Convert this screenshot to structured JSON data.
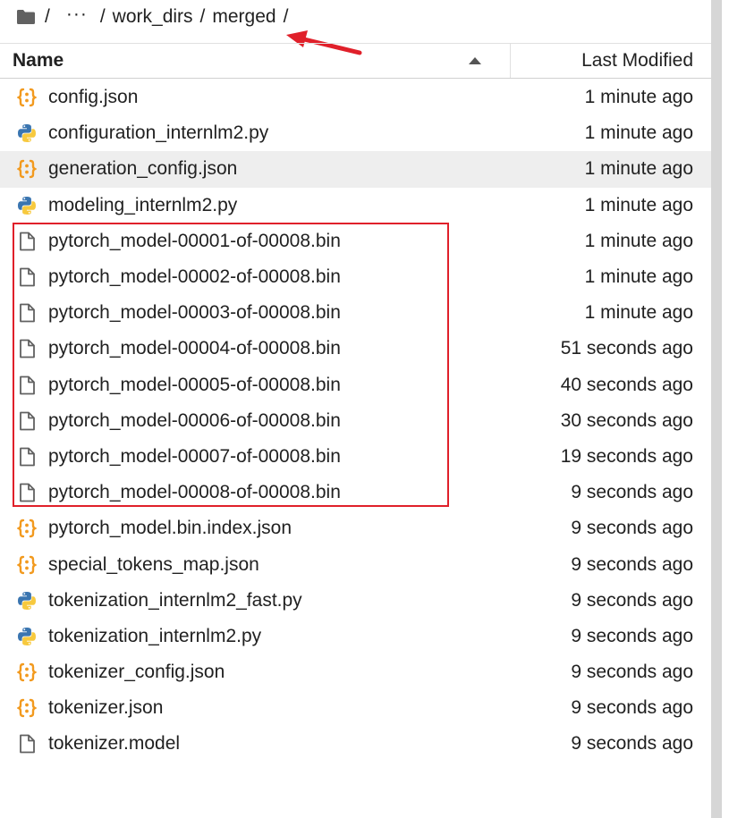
{
  "breadcrumb": {
    "root_icon": "folder-icon",
    "separator": "/",
    "ellipsis": "···",
    "segments": [
      "work_dirs",
      "merged"
    ],
    "trailing_separator": "/"
  },
  "annotation": {
    "arrow_color": "#e0202a",
    "highlight_color": "#e0202a"
  },
  "header": {
    "name_label": "Name",
    "modified_label": "Last Modified",
    "sort_direction": "ascending"
  },
  "files": [
    {
      "name": "config.json",
      "modified": "1 minute ago",
      "icon": "json-icon"
    },
    {
      "name": "configuration_internlm2.py",
      "modified": "1 minute ago",
      "icon": "python-icon"
    },
    {
      "name": "generation_config.json",
      "modified": "1 minute ago",
      "icon": "json-icon",
      "selected": true
    },
    {
      "name": "modeling_internlm2.py",
      "modified": "1 minute ago",
      "icon": "python-icon"
    },
    {
      "name": "pytorch_model-00001-of-00008.bin",
      "modified": "1 minute ago",
      "icon": "file-icon"
    },
    {
      "name": "pytorch_model-00002-of-00008.bin",
      "modified": "1 minute ago",
      "icon": "file-icon"
    },
    {
      "name": "pytorch_model-00003-of-00008.bin",
      "modified": "1 minute ago",
      "icon": "file-icon"
    },
    {
      "name": "pytorch_model-00004-of-00008.bin",
      "modified": "51 seconds ago",
      "icon": "file-icon"
    },
    {
      "name": "pytorch_model-00005-of-00008.bin",
      "modified": "40 seconds ago",
      "icon": "file-icon"
    },
    {
      "name": "pytorch_model-00006-of-00008.bin",
      "modified": "30 seconds ago",
      "icon": "file-icon"
    },
    {
      "name": "pytorch_model-00007-of-00008.bin",
      "modified": "19 seconds ago",
      "icon": "file-icon"
    },
    {
      "name": "pytorch_model-00008-of-00008.bin",
      "modified": "9 seconds ago",
      "icon": "file-icon"
    },
    {
      "name": "pytorch_model.bin.index.json",
      "modified": "9 seconds ago",
      "icon": "json-icon"
    },
    {
      "name": "special_tokens_map.json",
      "modified": "9 seconds ago",
      "icon": "json-icon"
    },
    {
      "name": "tokenization_internlm2_fast.py",
      "modified": "9 seconds ago",
      "icon": "python-icon"
    },
    {
      "name": "tokenization_internlm2.py",
      "modified": "9 seconds ago",
      "icon": "python-icon"
    },
    {
      "name": "tokenizer_config.json",
      "modified": "9 seconds ago",
      "icon": "json-icon"
    },
    {
      "name": "tokenizer.json",
      "modified": "9 seconds ago",
      "icon": "json-icon"
    },
    {
      "name": "tokenizer.model",
      "modified": "9 seconds ago",
      "icon": "file-icon"
    }
  ],
  "colors": {
    "json_icon": "#f29a1f",
    "python_blue": "#3a75b0",
    "python_yellow": "#f7c93e",
    "file_icon": "#616161",
    "selected_row": "#eeeeee"
  }
}
